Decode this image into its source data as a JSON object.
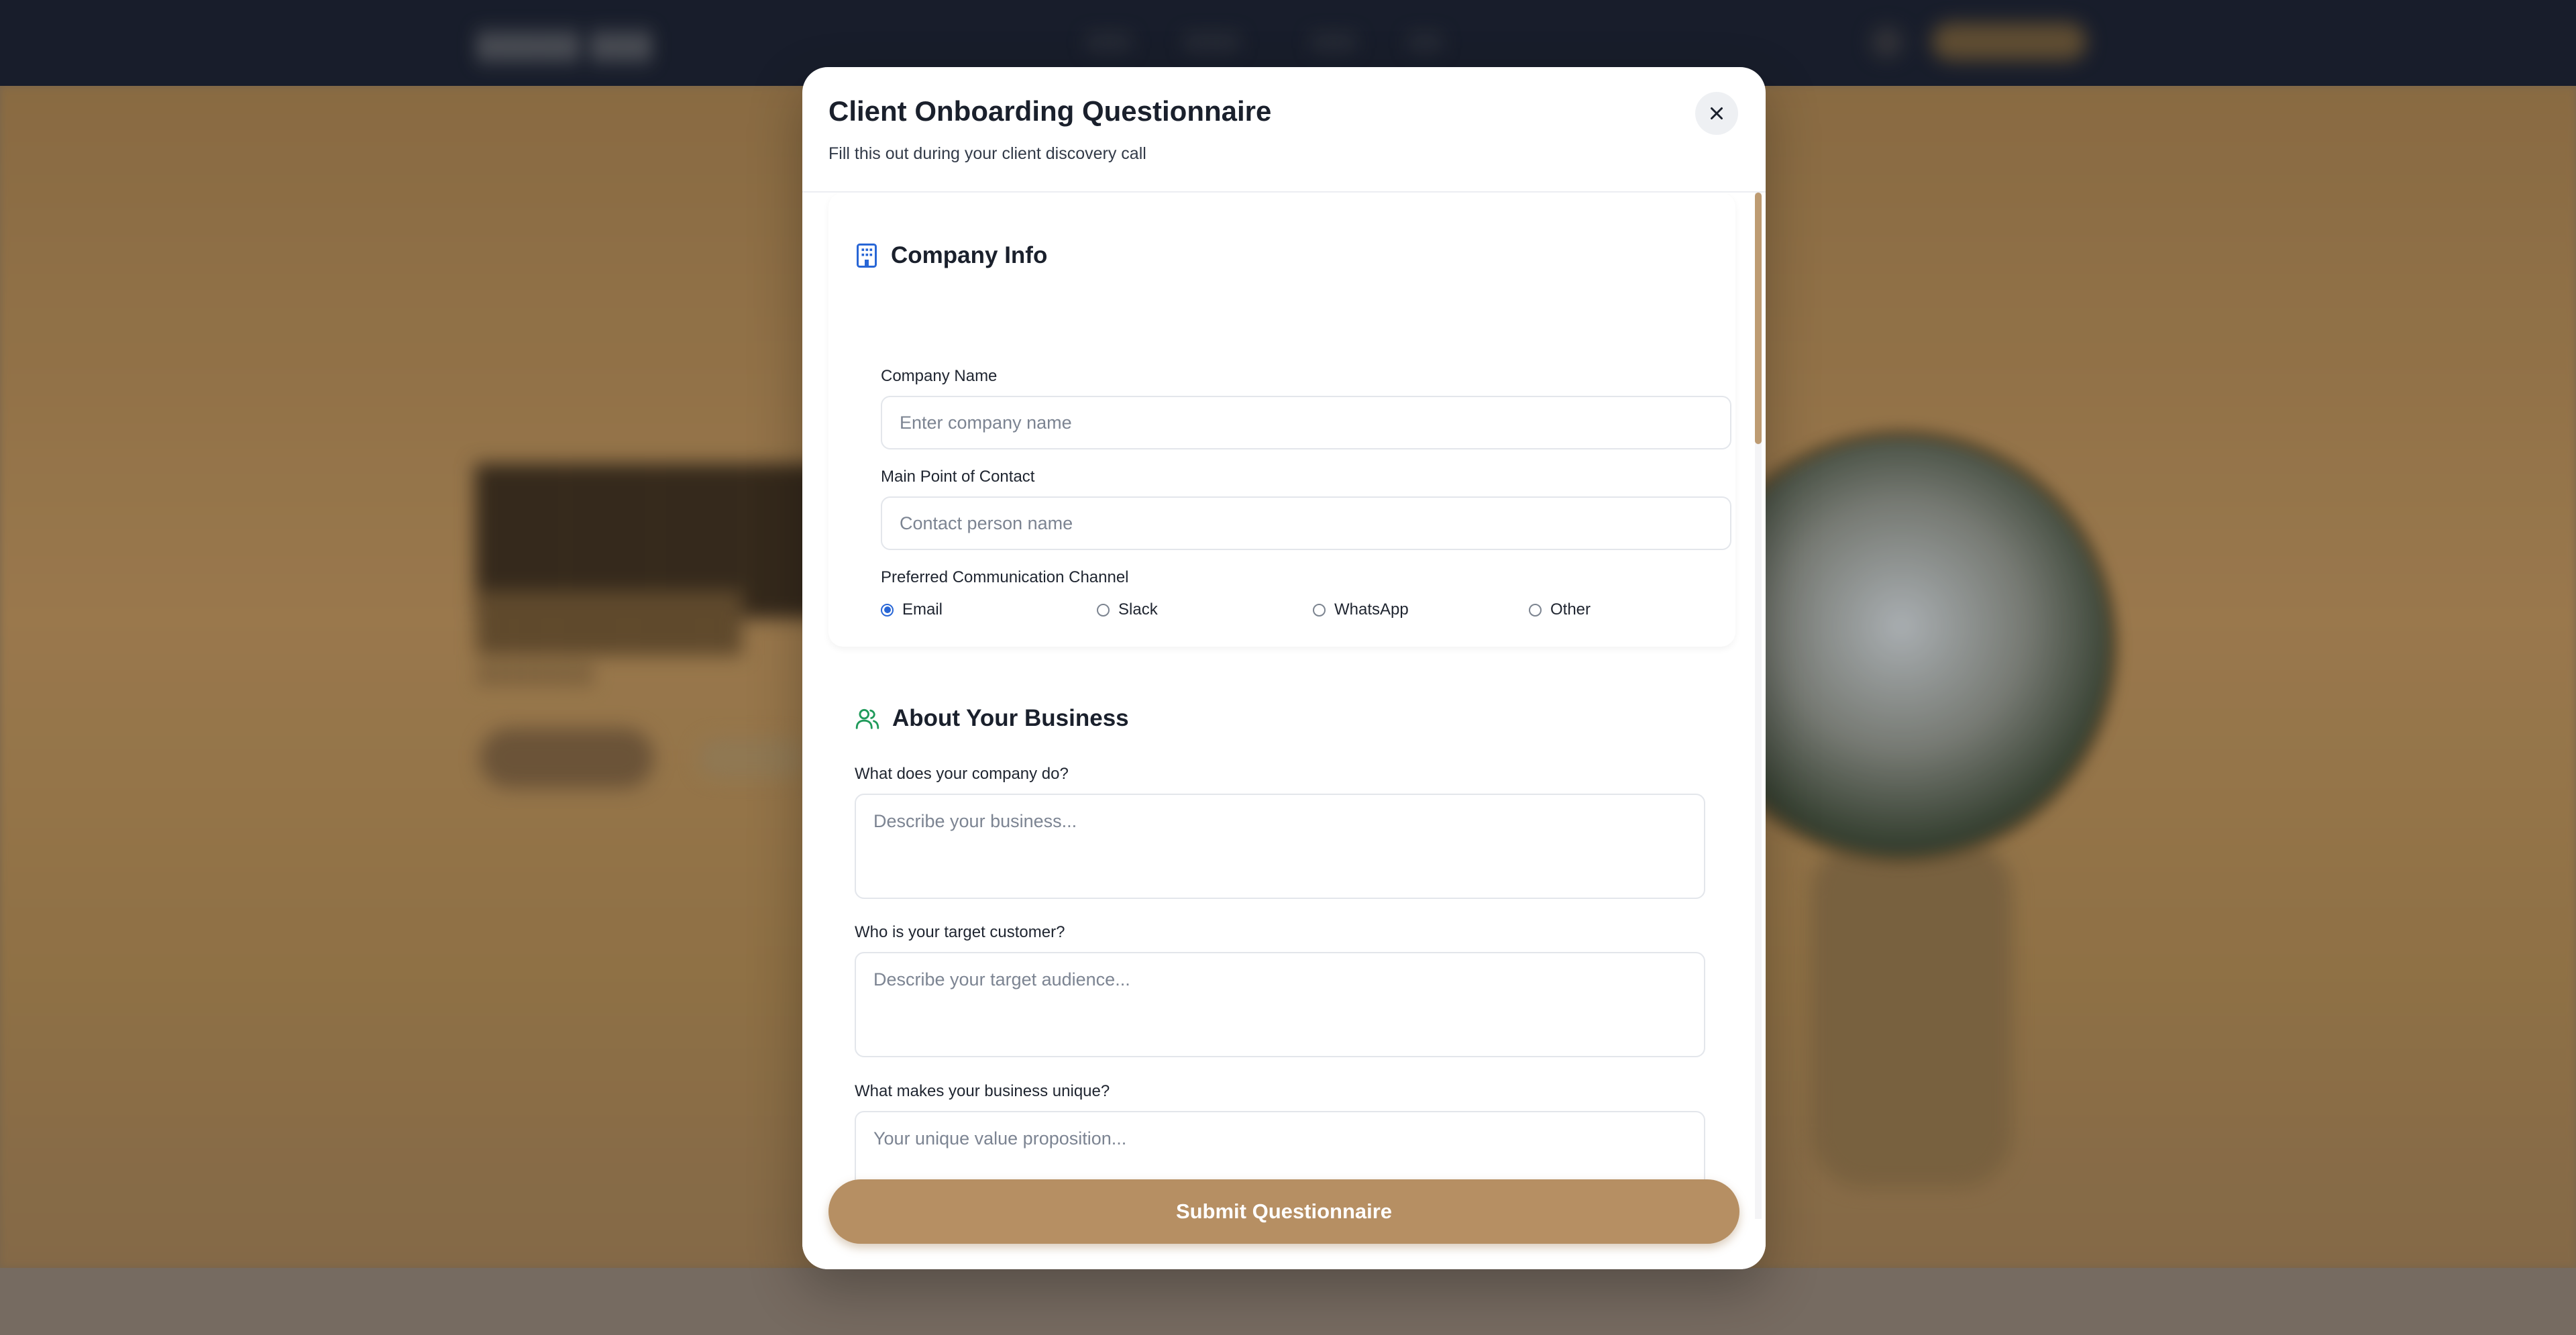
{
  "modal": {
    "title": "Client Onboarding Questionnaire",
    "subtitle": "Fill this out during your client discovery call",
    "close_icon": "close-icon",
    "submit_label": "Submit Questionnaire"
  },
  "company_info": {
    "title": "Company Info",
    "icon": "building-icon",
    "icon_color": "#2866d6",
    "company_name": {
      "label": "Company Name",
      "placeholder": "Enter company name",
      "value": ""
    },
    "contact": {
      "label": "Main Point of Contact",
      "placeholder": "Contact person name",
      "value": ""
    },
    "channel": {
      "label": "Preferred Communication Channel",
      "options": [
        "Email",
        "Slack",
        "WhatsApp",
        "Other"
      ],
      "selected": "Email"
    }
  },
  "about_business": {
    "title": "About Your Business",
    "icon": "users-icon",
    "icon_color": "#1f9a5a",
    "q1": {
      "label": "What does your company do?",
      "placeholder": "Describe your business..."
    },
    "q2": {
      "label": "Who is your target customer?",
      "placeholder": "Describe your target audience..."
    },
    "q3": {
      "label": "What makes your business unique?",
      "placeholder": "Your unique value proposition..."
    }
  },
  "colors": {
    "accent": "#b68f63",
    "radio_selected": "#2866d6",
    "nav_background": "#1a2030"
  }
}
